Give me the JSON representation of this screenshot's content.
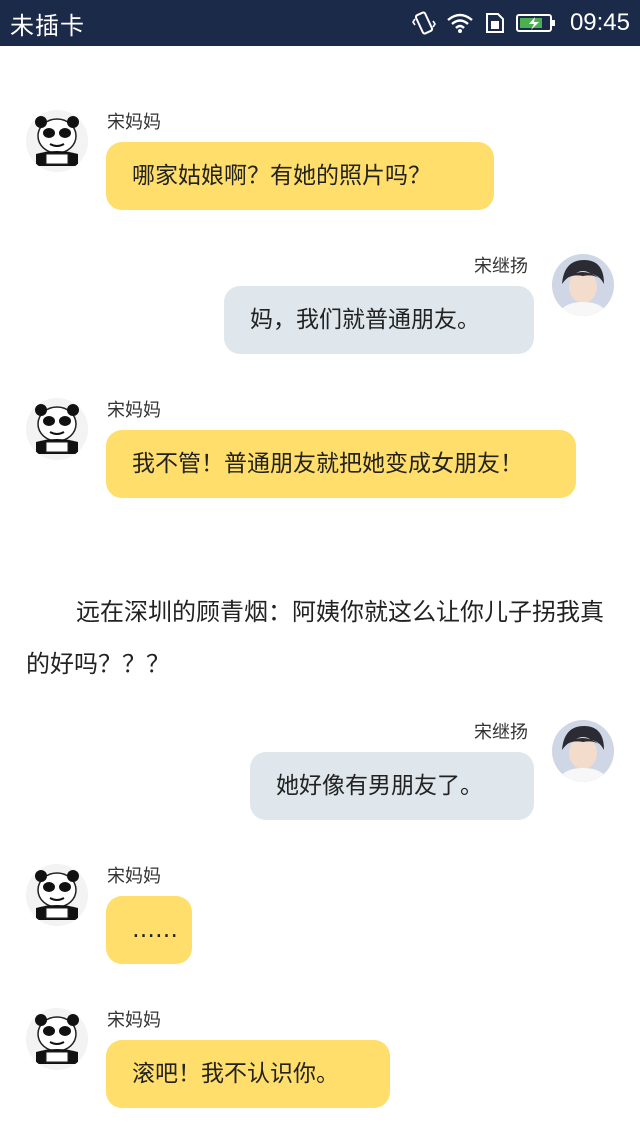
{
  "status_bar": {
    "carrier": "未插卡",
    "time": "09:45",
    "icons": [
      "vibrate-icon",
      "wifi-icon",
      "sim-icon",
      "battery-charging-icon"
    ]
  },
  "messages": [
    {
      "sender": "宋妈妈",
      "side": "left",
      "avatar": "panda-meme-avatar",
      "text": "哪家姑娘啊？有她的照片吗？"
    },
    {
      "sender": "宋继扬",
      "side": "right",
      "avatar": "young-man-avatar",
      "text": "妈，我们就普通朋友。"
    },
    {
      "sender": "宋妈妈",
      "side": "left",
      "avatar": "panda-meme-avatar",
      "text": "我不管！普通朋友就把她变成女朋友！"
    },
    {
      "sender": "宋继扬",
      "side": "right",
      "avatar": "young-man-avatar",
      "text": "她好像有男朋友了。"
    },
    {
      "sender": "宋妈妈",
      "side": "left",
      "avatar": "panda-meme-avatar",
      "text": "……"
    },
    {
      "sender": "宋妈妈",
      "side": "left",
      "avatar": "panda-meme-avatar",
      "text": "滚吧！我不认识你。"
    }
  ],
  "narration": "远在深圳的顾青烟：阿姨你就这么让你儿子拐我真的好吗？？？",
  "colors": {
    "status_bar_bg": "#1c2a4a",
    "left_bubble": "#ffde6b",
    "right_bubble": "#dfe7ec"
  }
}
